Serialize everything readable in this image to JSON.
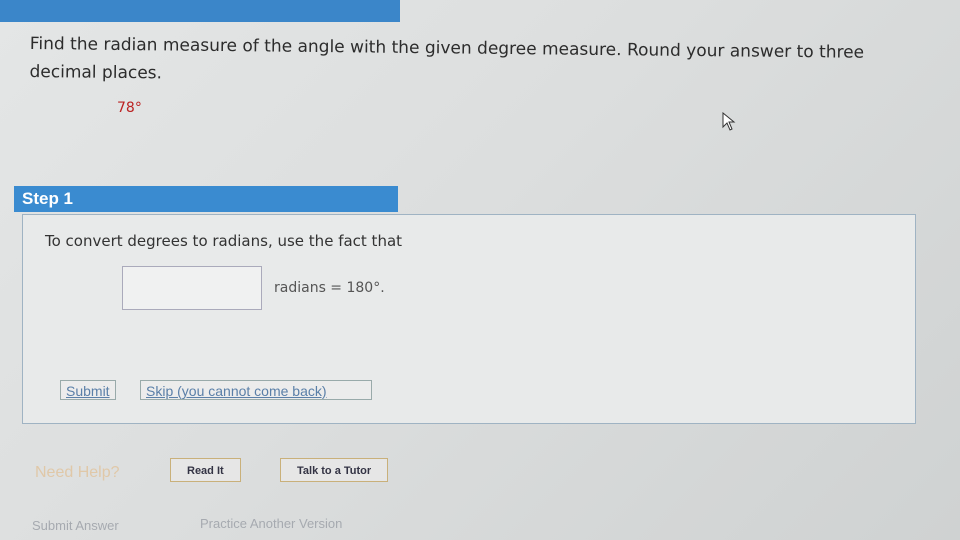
{
  "question": {
    "text": "Find the radian measure of the angle with the given degree measure. Round your answer to three decimal places.",
    "degree": "78°"
  },
  "step": {
    "title": "Step 1",
    "instruction": "To convert degrees to radians, use the fact that",
    "input_value": "",
    "equation_suffix": "radians = 180°.",
    "submit_label": "Submit",
    "skip_label": "Skip (you cannot come back)"
  },
  "help": {
    "label": "Need Help?",
    "read_it": "Read It",
    "talk_tutor": "Talk to a Tutor"
  },
  "footer": {
    "submit_answer": "Submit Answer",
    "practice": "Practice Another Version"
  },
  "colors": {
    "accent": "#3a8bd0",
    "degree": "#b22222"
  }
}
